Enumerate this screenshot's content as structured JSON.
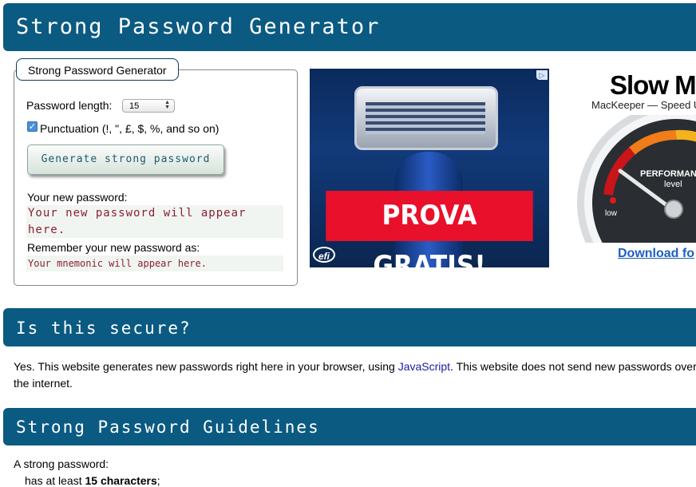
{
  "header": {
    "title": "Strong Password Generator"
  },
  "generator": {
    "legend": "Strong Password Generator",
    "length_label": "Password length:",
    "length_value": "15",
    "punctuation_checked": true,
    "punctuation_label": "Punctuation (!, \", £, $, %, and so on)",
    "generate_button": "Generate strong password",
    "new_password_label": "Your new password:",
    "new_password_placeholder": "Your new password will appear here.",
    "remember_label": "Remember your new password as:",
    "mnemonic_placeholder": "Your mnemonic will appear here."
  },
  "ad1": {
    "banner": "PROVA GRATIS!",
    "logo": "efi",
    "adchoices": "▷"
  },
  "ad2": {
    "title": "Slow M",
    "subtitle": "MacKeeper — Speed U",
    "gauge_label": "PERFORMAN",
    "gauge_sublabel": "level",
    "gauge_low": "low",
    "download": "Download fo"
  },
  "secure": {
    "heading": "Is this secure?",
    "text_before": "Yes. This website generates new passwords right here in your browser, using ",
    "link": "JavaScript",
    "text_after": ". This website does not send new passwords over the internet."
  },
  "guidelines": {
    "heading": "Strong Password Guidelines",
    "intro": "A strong password:",
    "line1_prefix": "has at least ",
    "line1_bold": "15 characters",
    "line1_suffix": ";"
  }
}
